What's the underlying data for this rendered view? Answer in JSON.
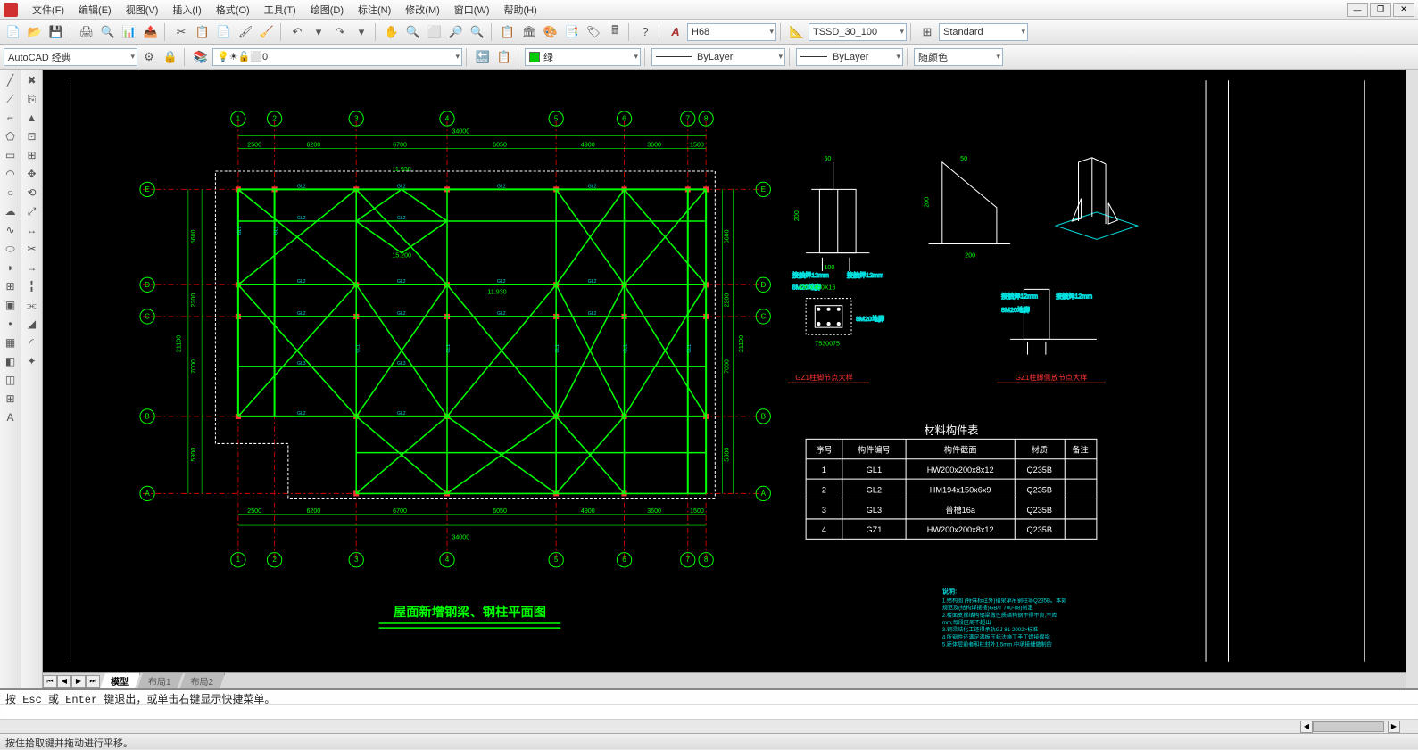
{
  "menu": {
    "items": [
      "文件(F)",
      "编辑(E)",
      "视图(V)",
      "插入(I)",
      "格式(O)",
      "工具(T)",
      "绘图(D)",
      "标注(N)",
      "修改(M)",
      "窗口(W)",
      "帮助(H)"
    ]
  },
  "toolbar1": {
    "icons": [
      "new",
      "open",
      "save",
      "sep",
      "print",
      "preview",
      "plot",
      "publish",
      "sep",
      "cut",
      "copy",
      "paste",
      "match",
      "sep",
      "eraser",
      "sep",
      "undo",
      "redo",
      "sep",
      "pan",
      "zoom-prev",
      "zoom-window",
      "zoom-ext",
      "zoom-realtime",
      "sep",
      "props",
      "design-center",
      "tool-palette",
      "sheet-set",
      "markup",
      "calc",
      "sep",
      "help"
    ],
    "text_style_icon": "A",
    "text_style": "H68",
    "dim_style": "TSSD_30_100",
    "table_style": "Standard"
  },
  "toolbar2": {
    "workspace": "AutoCAD 经典",
    "layer_current": "0",
    "color_label": "绿",
    "linetype": "ByLayer",
    "lineweight": "ByLayer",
    "plot_style": "随颜色"
  },
  "left_tools": [
    "╱",
    "╱",
    "⬛",
    "○",
    "◯",
    "⟋",
    "◠",
    "⬭",
    "◇",
    "pt",
    "⊞",
    "⊞",
    "⊞",
    "⊞",
    "▦",
    "A"
  ],
  "left_tools2": [
    "⤢",
    "✦",
    "▲",
    "⊡",
    "⊕",
    "⊡",
    "⟲",
    "↔",
    "┃",
    "□",
    "→",
    "⤴",
    "⤢",
    "╱",
    "✂",
    "✂"
  ],
  "sheet_tabs": {
    "active": "模型",
    "others": [
      "布局1",
      "布局2"
    ]
  },
  "command": {
    "log": "按 Esc 或 Enter 键退出，或单击右键显示快捷菜单。",
    "prompt": ""
  },
  "status": "按住拾取键并拖动进行平移。",
  "drawing": {
    "title": "屋面新增钢梁、钢柱平面图",
    "total_dim": "34000",
    "h_dims": [
      "2500",
      "6200",
      "6700",
      "6050",
      "4900",
      "3600",
      "1500"
    ],
    "v_dims_left": [
      "6600",
      "2200",
      "7000",
      "5300"
    ],
    "v_total": "21100",
    "grid_letters": [
      "A",
      "B",
      "C",
      "D",
      "E"
    ],
    "grid_numbers": [
      "1",
      "2",
      "3",
      "4",
      "5",
      "6",
      "7",
      "8"
    ],
    "table_title": "材料构件表",
    "table_headers": [
      "序号",
      "构件编号",
      "构件截面",
      "材质",
      "备注"
    ],
    "table_rows": [
      [
        "1",
        "GL1",
        "HW200x200x8x12",
        "Q235B",
        ""
      ],
      [
        "2",
        "GL2",
        "HM194x150x6x9",
        "Q235B",
        ""
      ],
      [
        "3",
        "GL3",
        "普槽16a",
        "Q235B",
        ""
      ],
      [
        "4",
        "GZ1",
        "HW200x200x8x12",
        "Q235B",
        ""
      ]
    ],
    "detail1_title": "GZ1柱脚节点大样",
    "detail2_title": "GZ1柱脚侧放节点大样",
    "detail_dim1": "50",
    "detail_dim2": "200",
    "detail_dim3": "100",
    "detail_dim4": "200",
    "detail_plate": "-450X450X16",
    "detail_bolt": "8M20地脚",
    "detail_weld": "接触焊12mm",
    "detail_holes": "7530075",
    "notes_title": "说明:",
    "notes": [
      "1.结构图 (特殊标注外)钢梁承吊钢柱等Q235B。本即",
      "   规范及(结构焊接接)GB/T 700-88)制定",
      "2.楼面支撑结构钢梁做性质结构钢不得不良,不应",
      "   mm;每段区周不超出",
      "3.钢梁结化工还得承轨GJ 81-2002>标准",
      "4.所钢件还满足满板压标法施工手工焊接焊指",
      "5.距体层前者和柱封外1.5mm.中承接缝做制的"
    ]
  }
}
